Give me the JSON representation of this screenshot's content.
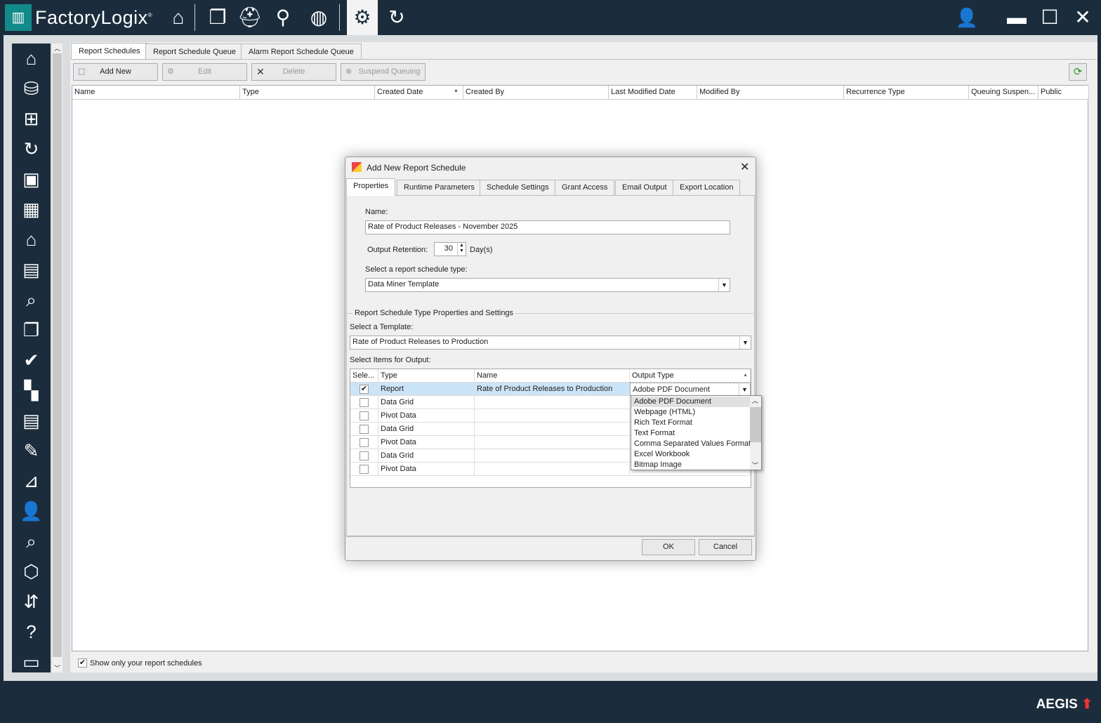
{
  "app": {
    "title_light": "Factory",
    "title_bold": "Logix",
    "registered": "®",
    "footer_logo": "AEGIS"
  },
  "topnav": [
    {
      "name": "home-icon",
      "glyph": "⌂"
    },
    {
      "name": "documents-icon",
      "glyph": "❐"
    },
    {
      "name": "hardhat-icon",
      "glyph": "⛑"
    },
    {
      "name": "location-pin-icon",
      "glyph": "⚲"
    },
    {
      "name": "globe-icon",
      "glyph": "◍"
    },
    {
      "name": "settings-gear-icon",
      "glyph": "⚙"
    },
    {
      "name": "report-refresh-icon",
      "glyph": "↻"
    }
  ],
  "window_controls": {
    "user": "👤",
    "minimize": "▬",
    "maximize": "☐",
    "close": "✕"
  },
  "sidebar": [
    "⌂",
    "⛁",
    "⊞",
    "↻",
    "▣",
    "▦",
    "⌂",
    "▤",
    "⌕",
    "❐",
    "✔",
    "▚",
    "▤",
    "✎",
    "⊿",
    "👤",
    "⌕",
    "⬡",
    "⇵",
    "?",
    "▭"
  ],
  "tabs": [
    {
      "label": "Report Schedules",
      "selected": true
    },
    {
      "label": "Report Schedule Queue"
    },
    {
      "label": "Alarm Report Schedule Queue"
    }
  ],
  "toolbar": {
    "add_new": "Add New",
    "edit": "Edit",
    "delete": "Delete",
    "suspend": "Suspend Queuing"
  },
  "columns": [
    "Name",
    "Type",
    "Created Date",
    "Created By",
    "Last Modified Date",
    "Modified By",
    "Recurrence Type",
    "Queuing Suspen...",
    "Public"
  ],
  "show_only_mine": {
    "label": "Show only your report schedules",
    "checked": true
  },
  "dialog": {
    "title": "Add New Report Schedule",
    "tabs": [
      "Properties",
      "Runtime Parameters",
      "Schedule Settings",
      "Grant Access",
      "Email Output",
      "Export Location"
    ],
    "name_label": "Name:",
    "name_value": "Rate of Product Releases - November 2025",
    "retention_label": "Output Retention:",
    "retention_value": "30",
    "retention_unit": "Day(s)",
    "type_label": "Select a report schedule type:",
    "type_value": "Data Miner Template",
    "group_label": "Report Schedule Type Properties and Settings",
    "template_label": "Select a Template:",
    "template_value": "Rate of Product Releases to Production",
    "items_label": "Select Items for Output:",
    "items_columns": [
      "Sele...",
      "Type",
      "Name",
      "Output Type"
    ],
    "items": [
      {
        "checked": true,
        "type": "Report",
        "name": "Rate of Product Releases to Production",
        "output": "Adobe PDF Document"
      },
      {
        "checked": false,
        "type": "Data Grid",
        "name": "",
        "output": ""
      },
      {
        "checked": false,
        "type": "Pivot Data",
        "name": "",
        "output": ""
      },
      {
        "checked": false,
        "type": "Data Grid",
        "name": "",
        "output": ""
      },
      {
        "checked": false,
        "type": "Pivot Data",
        "name": "",
        "output": ""
      },
      {
        "checked": false,
        "type": "Data Grid",
        "name": "",
        "output": ""
      },
      {
        "checked": false,
        "type": "Pivot Data",
        "name": "",
        "output": ""
      }
    ],
    "output_options": [
      "Adobe PDF Document",
      "Webpage (HTML)",
      "Rich Text Format",
      "Text Format",
      "Comma Separated Values Format",
      "Excel Workbook",
      "Bitmap Image"
    ],
    "ok": "OK",
    "cancel": "Cancel"
  },
  "colors": {
    "header": "#1b2d3d",
    "brand_teal": "#138a8a",
    "selected_row": "#cce4f7"
  }
}
